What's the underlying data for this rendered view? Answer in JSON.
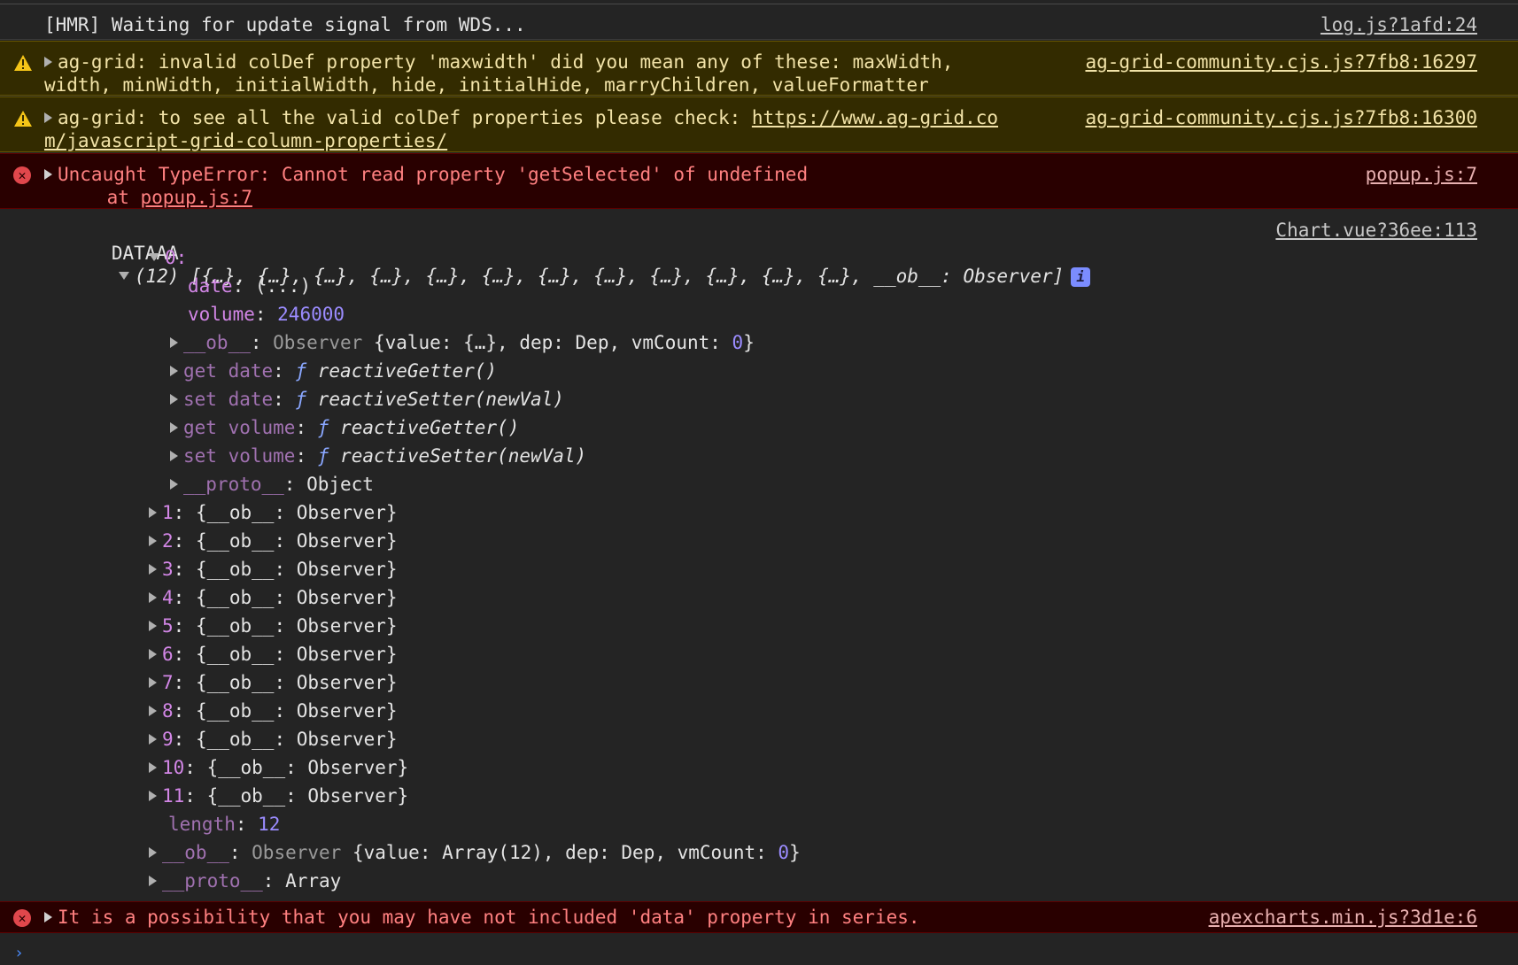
{
  "messages": {
    "hmr": {
      "text": "[HMR] Waiting for update signal from WDS...",
      "source": "log.js?1afd:24"
    },
    "warn1": {
      "line1": "ag-grid: invalid colDef property 'maxwidth' did you mean any of these: maxWidth,",
      "line2": "width, minWidth, initialWidth, hide, initialHide, marryChildren, valueFormatter",
      "source": "ag-grid-community.cjs.js?7fb8:16297"
    },
    "warn2": {
      "line1_prefix": "ag-grid: to see all the valid colDef properties please check: ",
      "line1_link": "https://www.ag-grid.co",
      "line2_link": "m/javascript-grid-column-properties/",
      "source": "ag-grid-community.cjs.js?7fb8:16300"
    },
    "err1": {
      "line1": "Uncaught TypeError: Cannot read property 'getSelected' of undefined",
      "line2_prefix": "    at ",
      "line2_link": "popup.js:7",
      "source": "popup.js:7"
    },
    "err2": {
      "text": "It is a possibility that you may have not included 'data' property in series.",
      "source": "apexcharts.min.js?3d1e:6"
    }
  },
  "dataaa": {
    "label": "DATAAA",
    "summary": "(12) [{…}, {…}, {…}, {…}, {…}, {…}, {…}, {…}, {…}, {…}, {…}, {…}, __ob__: Observer]",
    "source": "Chart.vue?36ee:113",
    "info_icon": "i",
    "item0": {
      "key": "0:",
      "date_key": "date",
      "date_val": "(...)",
      "volume_key": "volume",
      "volume_val": "246000",
      "ob_key": "__ob__",
      "ob_type": "Observer",
      "ob_body_1": "{value: {…}, dep: Dep, vmCount: ",
      "ob_vmcount": "0",
      "ob_body_2": "}",
      "get_date_key": "get date",
      "set_date_key": "set date",
      "get_volume_key": "get volume",
      "set_volume_key": "set volume",
      "f": "ƒ",
      "getter": "reactiveGetter()",
      "setter": "reactiveSetter(newVal)",
      "proto_key": "__proto__",
      "proto_val": "Object"
    },
    "items": [
      {
        "key": "1",
        "val": "{__ob__: Observer}"
      },
      {
        "key": "2",
        "val": "{__ob__: Observer}"
      },
      {
        "key": "3",
        "val": "{__ob__: Observer}"
      },
      {
        "key": "4",
        "val": "{__ob__: Observer}"
      },
      {
        "key": "5",
        "val": "{__ob__: Observer}"
      },
      {
        "key": "6",
        "val": "{__ob__: Observer}"
      },
      {
        "key": "7",
        "val": "{__ob__: Observer}"
      },
      {
        "key": "8",
        "val": "{__ob__: Observer}"
      },
      {
        "key": "9",
        "val": "{__ob__: Observer}"
      },
      {
        "key": "10",
        "val": "{__ob__: Observer}"
      },
      {
        "key": "11",
        "val": "{__ob__: Observer}"
      }
    ],
    "length_key": "length",
    "length_val": "12",
    "ob_key": "__ob__",
    "ob_type": "Observer",
    "ob_body_1": "{value: Array(12), dep: Dep, vmCount: ",
    "ob_vmcount": "0",
    "ob_body_2": "}",
    "proto_key": "__proto__",
    "proto_val": "Array"
  },
  "icons": {
    "warning": "warning-triangle-icon",
    "error": "error-circle-icon",
    "expand": "expand-triangle-icon",
    "collapse": "collapse-triangle-icon",
    "info": "info-icon",
    "prompt": "console-prompt-icon"
  },
  "colors": {
    "background": "#242424",
    "warning_bg": "#332b00",
    "warning_text": "#f2e3a8",
    "error_bg": "#290000",
    "error_text": "#ff8080",
    "key": "#d286e6",
    "number": "#9b8cff"
  }
}
